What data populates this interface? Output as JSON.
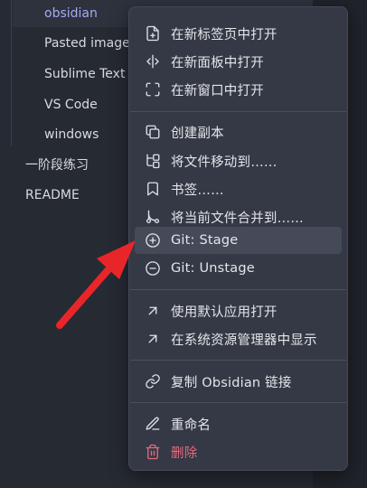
{
  "sidebar": {
    "items": [
      {
        "label": "obsidian",
        "active": true
      },
      {
        "label": "Pasted image"
      },
      {
        "label": "Sublime Text"
      },
      {
        "label": "VS Code"
      },
      {
        "label": "windows"
      },
      {
        "label": "一阶段练习"
      },
      {
        "label": "README"
      }
    ]
  },
  "menu": {
    "items": [
      {
        "label": "在新标签页中打开",
        "icon": "file-plus-icon"
      },
      {
        "label": "在新面板中打开",
        "icon": "split-pane-icon"
      },
      {
        "label": "在新窗口中打开",
        "icon": "maximize-icon"
      },
      {
        "label": "创建副本",
        "icon": "copy-icon"
      },
      {
        "label": "将文件移动到……",
        "icon": "folder-tree-icon"
      },
      {
        "label": "书签……",
        "icon": "bookmark-icon"
      },
      {
        "label": "将当前文件合并到……",
        "icon": "git-merge-icon"
      },
      {
        "label": "Git: Stage",
        "icon": "plus-circle-icon"
      },
      {
        "label": "Git: Unstage",
        "icon": "minus-circle-icon"
      },
      {
        "label": "使用默认应用打开",
        "icon": "arrow-up-right-icon"
      },
      {
        "label": "在系统资源管理器中显示",
        "icon": "arrow-up-right-icon"
      },
      {
        "label": "复制 Obsidian 链接",
        "icon": "link-icon"
      },
      {
        "label": "重命名",
        "icon": "pencil-icon"
      },
      {
        "label": "删除",
        "icon": "trash-icon"
      }
    ]
  },
  "colors": {
    "accent_active": "#a7aaf2",
    "danger": "#e5697b",
    "arrow": "#e8262a"
  }
}
